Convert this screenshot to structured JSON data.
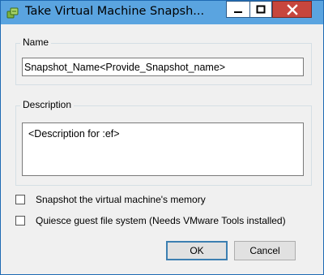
{
  "window": {
    "title": "Take Virtual Machine Snapsh...",
    "titlebar_color": "#5aa4e0",
    "close_button_color": "#c7463d"
  },
  "name_group": {
    "label": "Name",
    "value": "Snapshot_Name<Provide_Snapshot_name>"
  },
  "description_group": {
    "label": "Description",
    "value": "<Description for :ef>"
  },
  "options": [
    {
      "label": "Snapshot the virtual machine's memory",
      "checked": false
    },
    {
      "label": "Quiesce guest file system (Needs VMware Tools installed)",
      "checked": false
    }
  ],
  "buttons": {
    "ok_label": "OK",
    "cancel_label": "Cancel"
  },
  "icons": {
    "title": "snapshot-icon",
    "minimize": "minimize-icon",
    "maximize": "maximize-icon",
    "close": "close-icon"
  }
}
